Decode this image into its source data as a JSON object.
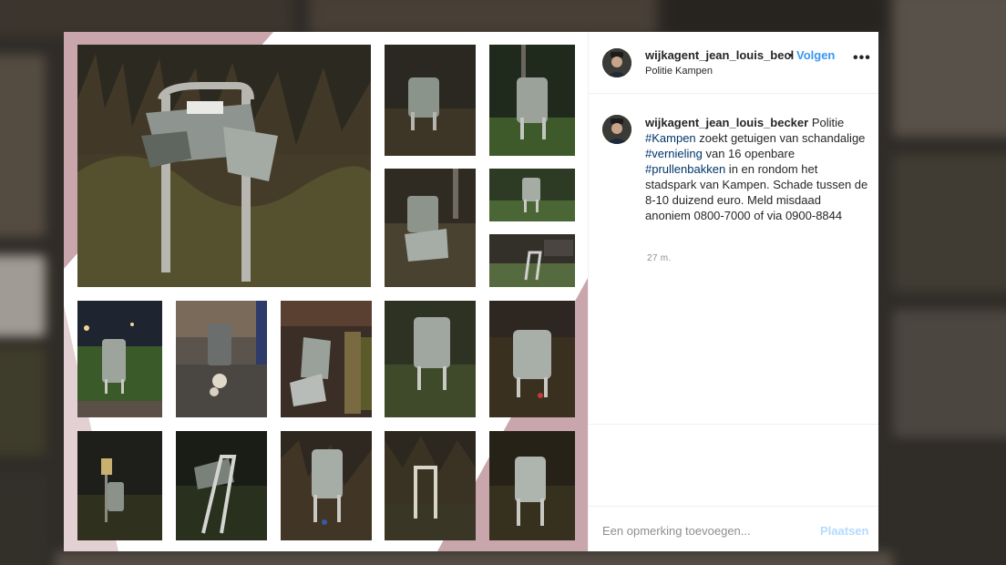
{
  "post": {
    "username_header": "wijkagent_jean_louis_becl",
    "separator": "•",
    "follow_label": "Volgen",
    "location": "Politie Kampen",
    "more_icon": "more-horizontal-icon",
    "more_glyph": "•••",
    "caption": {
      "username": "wijkagent_jean_louis_becker",
      "text1": " Politie ",
      "tag1": "#Kampen",
      "text2": " zoekt getuigen van schandalige ",
      "tag2": "#vernieling",
      "text3": " van 16 openbare ",
      "tag3": "#prullenbakken",
      "text4": " in en rondom het stadspark van Kampen. Schade tussen de 8-10 duizend euro. Meld misdaad anoniem 0800-7000 of via 0900-8844"
    },
    "timestamp": "27 m.",
    "comment_placeholder": "Een opmerking toevoegen...",
    "post_label": "Plaatsen"
  },
  "media": {
    "photo_count": 16,
    "subject": "damaged-trash-bin"
  },
  "colors": {
    "link": "#3897f0",
    "hashtag": "#003569",
    "post_disabled": "#b3dbff",
    "collage_accent": "#c9a6ab"
  }
}
